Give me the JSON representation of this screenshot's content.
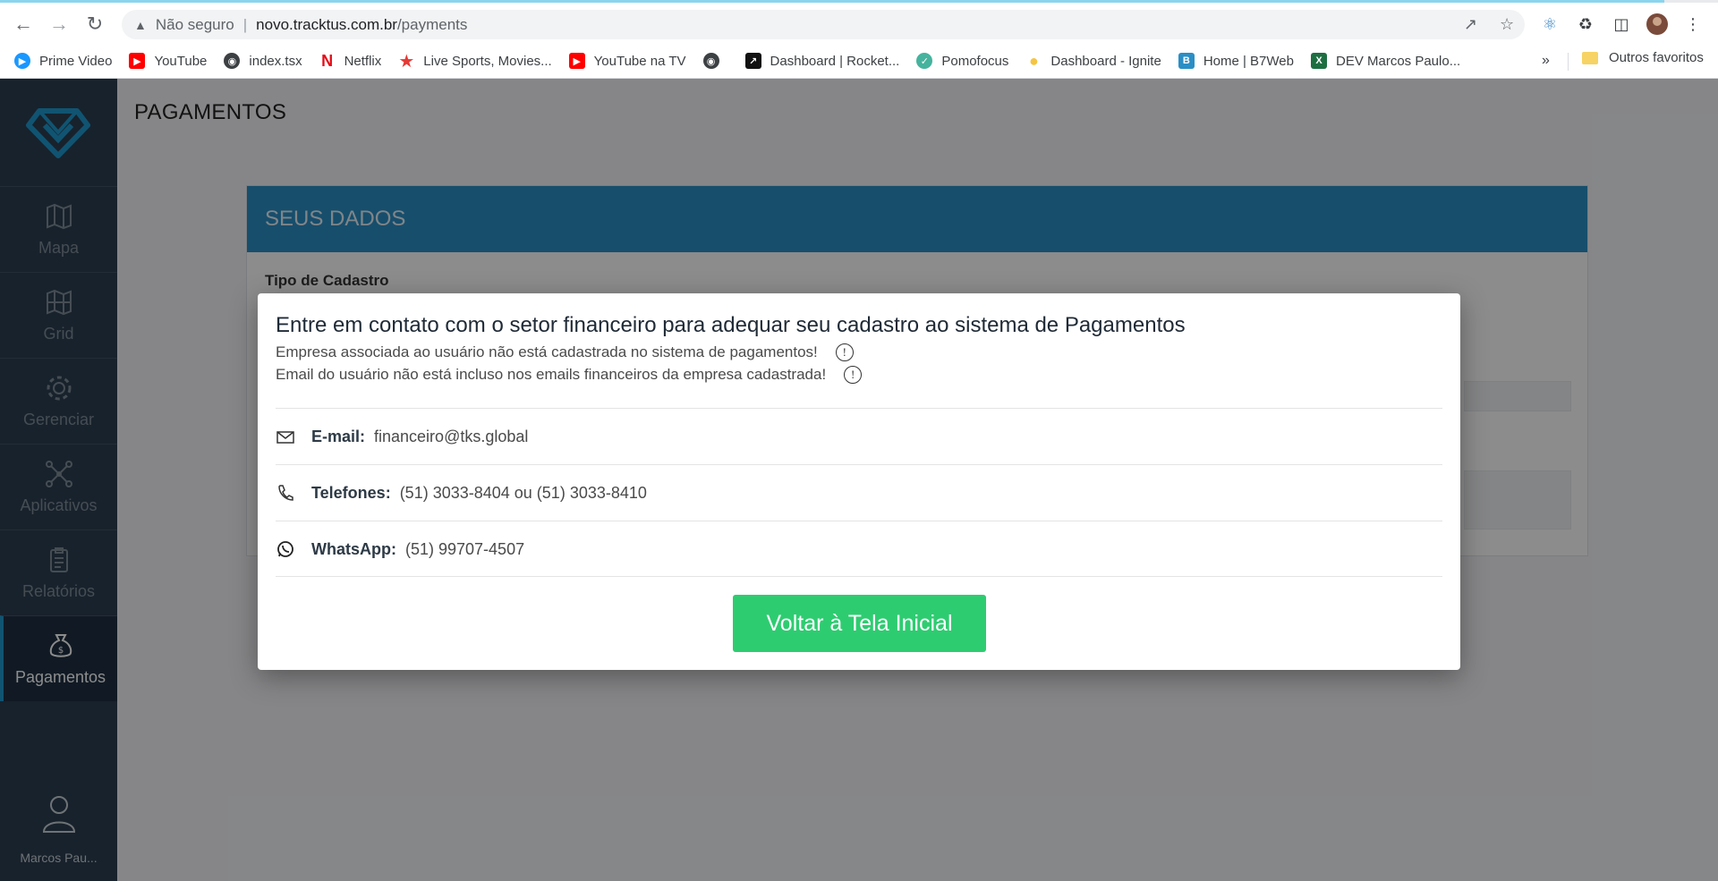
{
  "browser": {
    "omnibox": {
      "security": "Não seguro",
      "host": "novo.tracktus.com.br",
      "path": "/payments"
    },
    "bookmarks": [
      {
        "label": "Prime Video",
        "icon": "prime-video-icon",
        "color": "#1a98ff"
      },
      {
        "label": "YouTube",
        "icon": "youtube-icon",
        "color": "#ff0000"
      },
      {
        "label": "index.tsx",
        "icon": "globe-icon",
        "color": "#3c4043"
      },
      {
        "label": "Netflix",
        "icon": "netflix-icon",
        "color": "#e50914"
      },
      {
        "label": "Live Sports, Movies...",
        "icon": "star-icon",
        "color": "#e53935"
      },
      {
        "label": "YouTube na TV",
        "icon": "youtube-icon",
        "color": "#ff0000"
      },
      {
        "label": "",
        "icon": "globe-icon",
        "color": "#3c4043"
      },
      {
        "label": "Dashboard | Rocket...",
        "icon": "rocketseat-icon",
        "color": "#111111"
      },
      {
        "label": "Pomofocus",
        "icon": "check-icon",
        "color": "#45b39d"
      },
      {
        "label": "Dashboard - Ignite",
        "icon": "bulb-icon",
        "color": "#f5c542"
      },
      {
        "label": "Home | B7Web",
        "icon": "b7web-icon",
        "color": "#2b8fc5"
      },
      {
        "label": "DEV Marcos Paulo...",
        "icon": "excel-icon",
        "color": "#1d6f42"
      }
    ],
    "more": "»",
    "other_favorites": "Outros favoritos"
  },
  "sidebar": {
    "items": [
      {
        "label": "Mapa",
        "icon": "map-icon"
      },
      {
        "label": "Grid",
        "icon": "grid-map-icon"
      },
      {
        "label": "Gerenciar",
        "icon": "gear-icon"
      },
      {
        "label": "Aplicativos",
        "icon": "network-icon"
      },
      {
        "label": "Relatórios",
        "icon": "clipboard-icon"
      },
      {
        "label": "Pagamentos",
        "icon": "money-bag-icon"
      }
    ],
    "user": "Marcos Pau..."
  },
  "page": {
    "title": "PAGAMENTOS",
    "card_header": "SEUS DADOS",
    "card_label": "Tipo de Cadastro"
  },
  "modal": {
    "title": "Entre em contato com o setor financeiro para adequar seu cadastro ao sistema de Pagamentos",
    "messages": [
      "Empresa associada ao usuário não está cadastrada no sistema de pagamentos!",
      "Email do usuário não está incluso nos emails financeiros da empresa cadastrada!"
    ],
    "info_glyph": "!",
    "email": {
      "label": "E-mail:",
      "value": "financeiro@tks.global"
    },
    "phones": {
      "label": "Telefones:",
      "value": "(51) 3033-8404 ou  (51) 3033-8410"
    },
    "whatsapp": {
      "label": "WhatsApp:",
      "value": "(51) 99707-4507"
    },
    "button": "Voltar à Tela Inicial",
    "button_color": "#2ecc71"
  }
}
